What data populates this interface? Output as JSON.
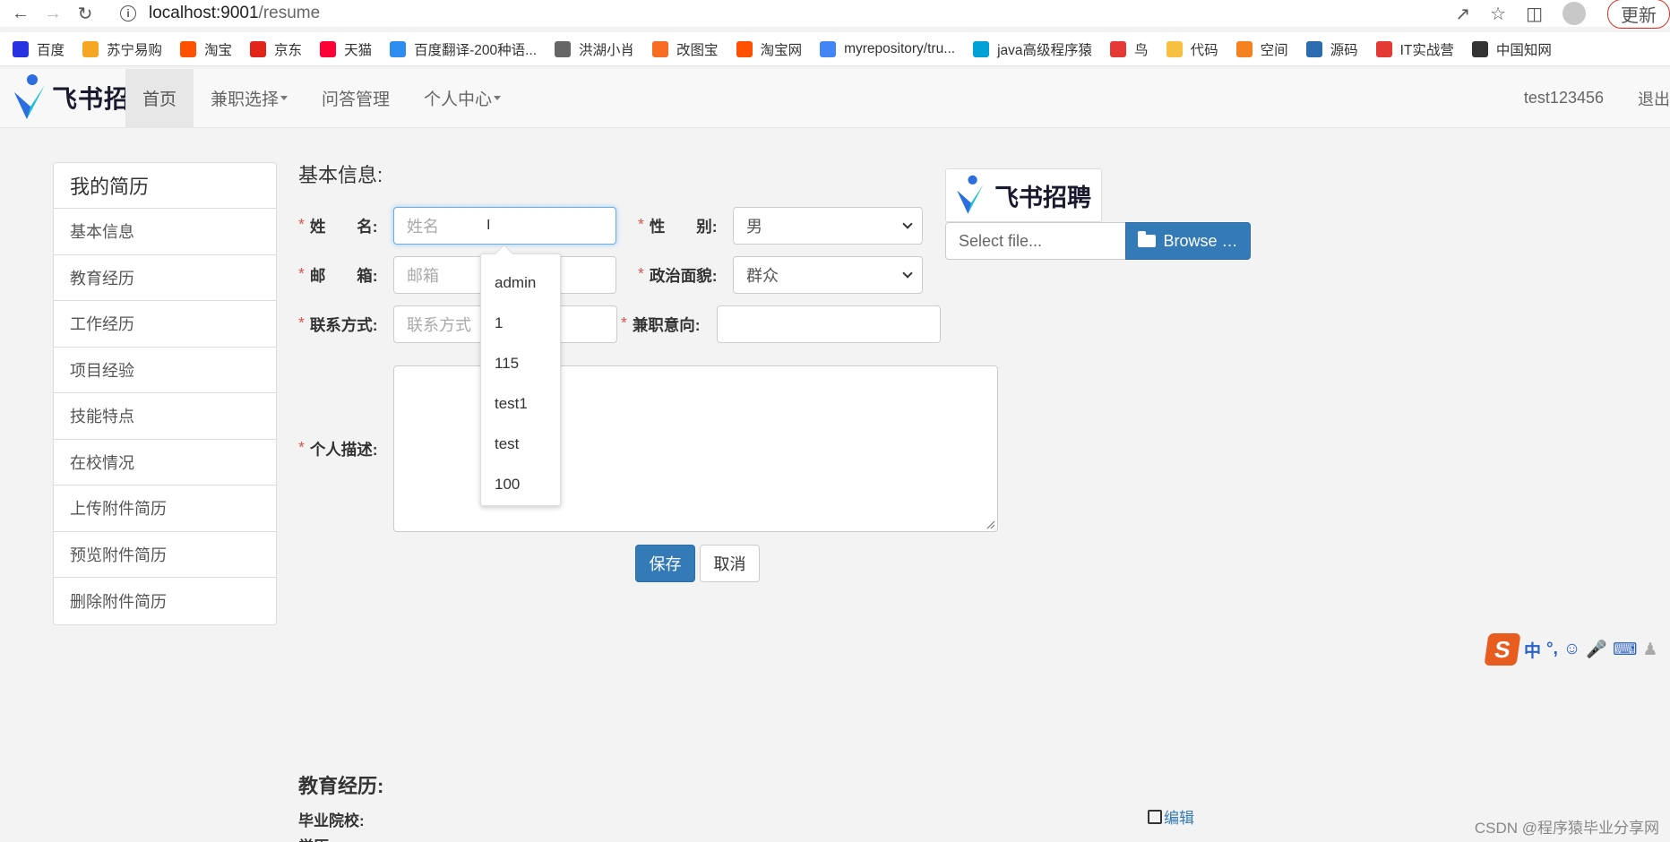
{
  "browser": {
    "url_host": "localhost:9001",
    "url_path": "/resume",
    "update_label": "更新"
  },
  "bookmarks": [
    {
      "label": "百度",
      "color": "#2932e1"
    },
    {
      "label": "苏宁易购",
      "color": "#f5a623"
    },
    {
      "label": "淘宝",
      "color": "#ff5000"
    },
    {
      "label": "京东",
      "color": "#e1251b"
    },
    {
      "label": "天猫",
      "color": "#ff0036"
    },
    {
      "label": "百度翻译-200种语...",
      "color": "#2d8cf0"
    },
    {
      "label": "洪湖小肖",
      "color": "#666666"
    },
    {
      "label": "改图宝",
      "color": "#f56c22"
    },
    {
      "label": "淘宝网",
      "color": "#ff5000"
    },
    {
      "label": "myrepository/tru...",
      "color": "#4285f4"
    },
    {
      "label": "java高级程序猿",
      "color": "#00a1d6"
    },
    {
      "label": "鸟",
      "color": "#e53935"
    },
    {
      "label": "代码",
      "color": "#f6c141"
    },
    {
      "label": "空间",
      "color": "#f58220"
    },
    {
      "label": "源码",
      "color": "#2b6cb0"
    },
    {
      "label": "IT实战营",
      "color": "#e53935"
    },
    {
      "label": "中国知网",
      "color": "#333333"
    }
  ],
  "site": {
    "logo_text": "飞书招聘",
    "nav": [
      {
        "label": "首页",
        "active": true,
        "dropdown": false
      },
      {
        "label": "兼职选择",
        "active": false,
        "dropdown": true
      },
      {
        "label": "问答管理",
        "active": false,
        "dropdown": false
      },
      {
        "label": "个人中心",
        "active": false,
        "dropdown": true
      }
    ],
    "username": "test123456",
    "logout": "退出"
  },
  "sidebar": {
    "title": "我的简历",
    "items": [
      "基本信息",
      "教育经历",
      "工作经历",
      "项目经验",
      "技能特点",
      "在校情况",
      "上传附件简历",
      "预览附件简历",
      "删除附件简历"
    ]
  },
  "form": {
    "section_title": "基本信息:",
    "name_label": "姓　　名:",
    "name_placeholder": "姓名",
    "gender_label": "性　　别:",
    "gender_value": "男",
    "email_label": "邮　　箱:",
    "email_placeholder": "邮箱",
    "political_label": "政治面貌:",
    "political_value": "群众",
    "contact_label": "联系方式:",
    "contact_placeholder": "联系方式",
    "intent_label": "兼职意向:",
    "intent_value": "",
    "desc_label": "个人描述:",
    "save": "保存",
    "cancel": "取消"
  },
  "autocomplete": [
    "admin",
    "1",
    "115",
    "test1",
    "test",
    "100"
  ],
  "upload": {
    "logo_text": "飞书招聘",
    "file_placeholder": "Select file...",
    "browse": "Browse …"
  },
  "ime": {
    "lang": "中",
    "punct": "°,"
  },
  "education": {
    "title": "教育经历:",
    "school_label": "毕业院校:",
    "degree_label": "学历:",
    "edit": "编辑"
  },
  "watermark": "CSDN @程序猿毕业分享网"
}
